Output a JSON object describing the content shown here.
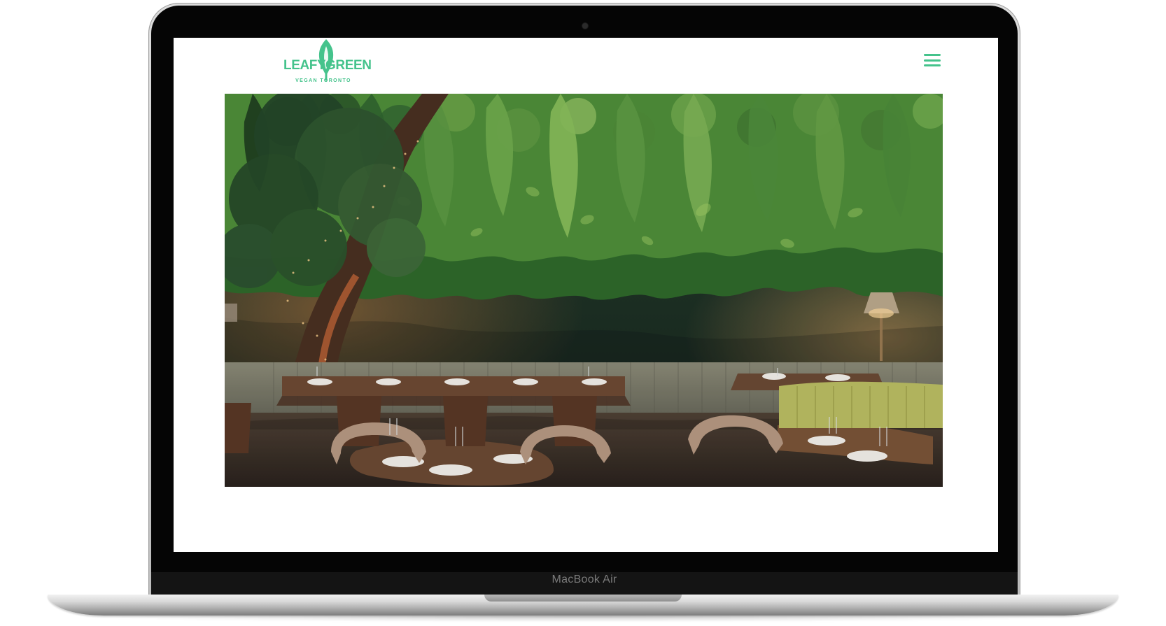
{
  "device": {
    "label": "MacBook Air"
  },
  "site": {
    "logo_left": "LEAFY",
    "logo_right": "GREEN",
    "logo_tagline": "VEGAN TORONTO"
  },
  "header": {
    "menu_icon": "hamburger-menu-icon"
  },
  "hero": {
    "scene": "restaurant-dining-room-with-green-wall"
  },
  "colors": {
    "brand": "#45c38c",
    "screen_bg": "#ffffff",
    "bezel": "#050505"
  }
}
